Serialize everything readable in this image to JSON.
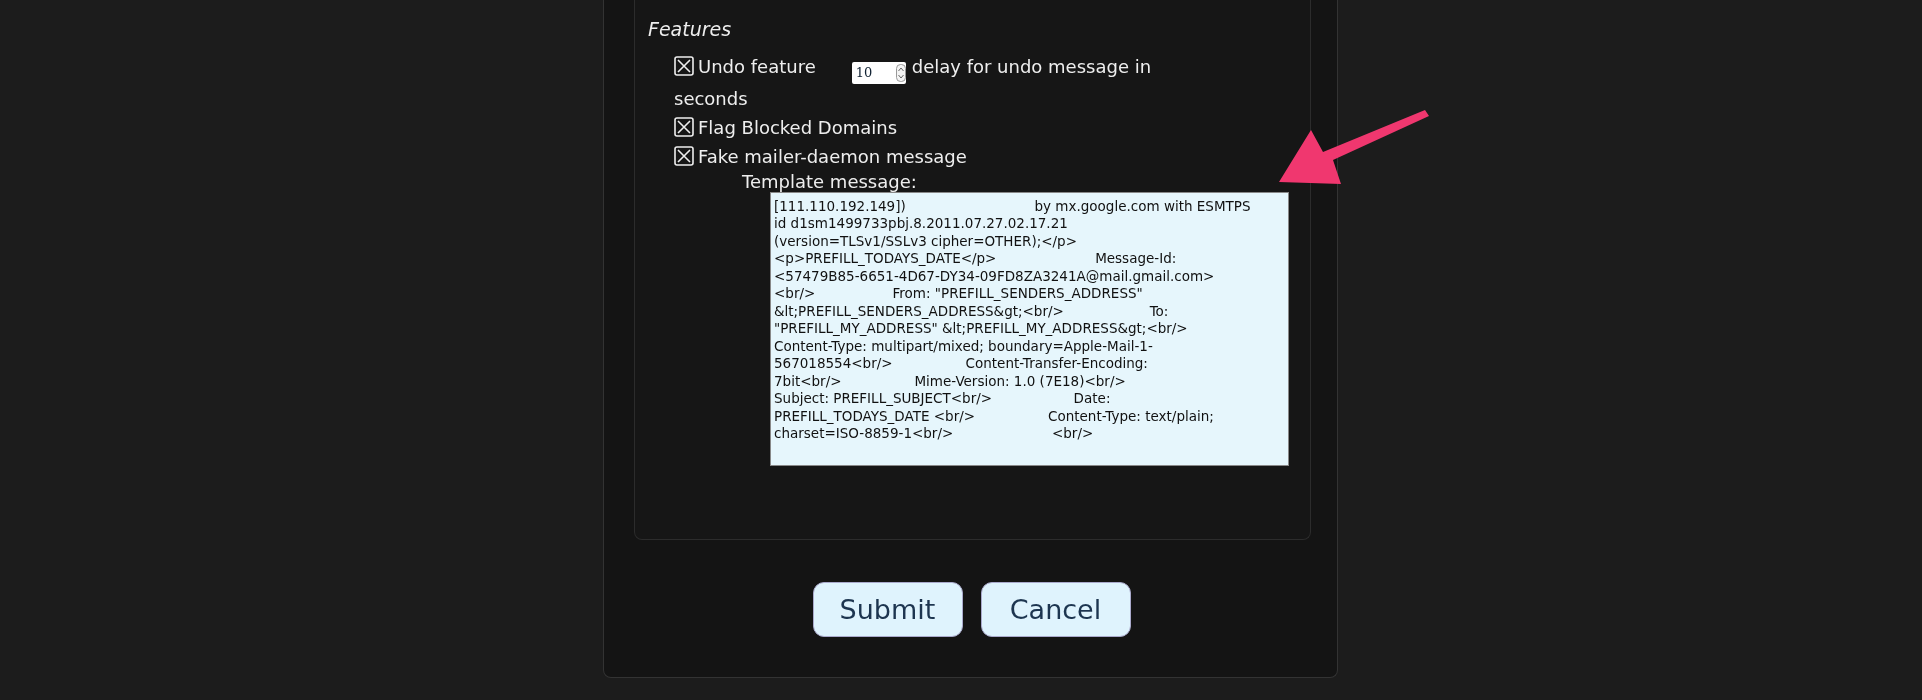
{
  "section": {
    "title": "Features"
  },
  "options": [
    {
      "kind": "spinner",
      "label": "Undo feature",
      "checked": true,
      "spinner_value": "10",
      "suffix": "delay for undo message in",
      "suffix_continued": "seconds"
    },
    {
      "kind": "plain",
      "label": "Flag Blocked Domains",
      "checked": true
    },
    {
      "kind": "plain",
      "label": "Fake mailer-daemon message",
      "checked": true
    }
  ],
  "template": {
    "label": "Template message:",
    "value": "[111.110.192.149])                              by mx.google.com with ESMTPS\nid d1sm1499733pbj.8.2011.07.27.02.17.21\n(version=TLSv1/SSLv3 cipher=OTHER);</p>\n<p>PREFILL_TODAYS_DATE</p>                       Message-Id:\n<57479B85-6651-4D67-DY34-09FD8ZA3241A@mail.gmail.com>\n<br/>                  From: \"PREFILL_SENDERS_ADDRESS\"\n&lt;PREFILL_SENDERS_ADDRESS&gt;<br/>                    To:\n\"PREFILL_MY_ADDRESS\" &lt;PREFILL_MY_ADDRESS&gt;<br/>\nContent-Type: multipart/mixed; boundary=Apple-Mail-1-\n567018554<br/>                 Content-Transfer-Encoding:\n7bit<br/>                 Mime-Version: 1.0 (7E18)<br/>\nSubject: PREFILL_SUBJECT<br/>                   Date:\nPREFILL_TODAYS_DATE <br/>                 Content-Type: text/plain;\ncharset=ISO-8859-1<br/>                       <br/>"
  },
  "buttons": [
    "Submit",
    "Cancel"
  ]
}
